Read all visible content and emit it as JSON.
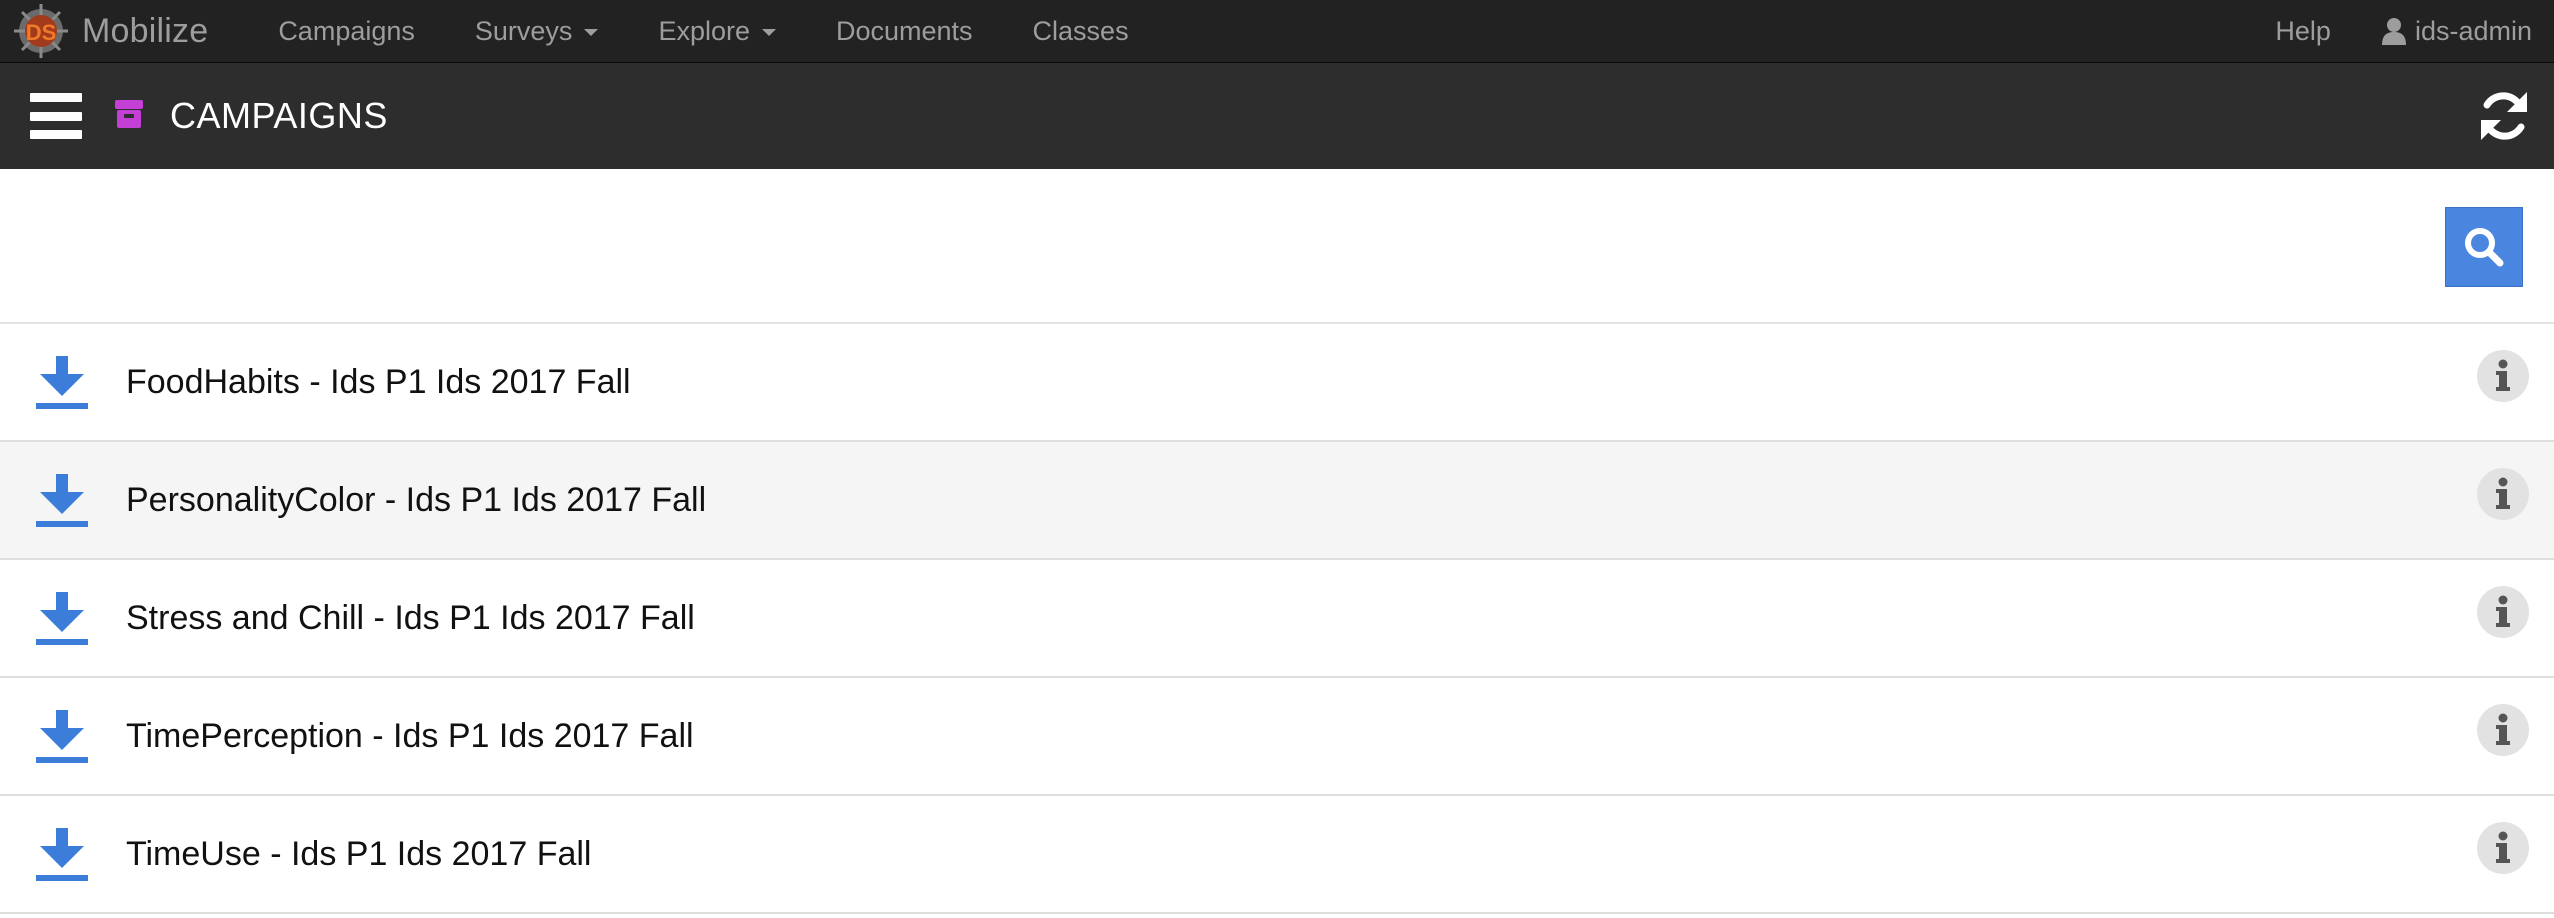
{
  "navbar": {
    "brand": "Mobilize",
    "items": [
      {
        "label": "Campaigns",
        "dropdown": false
      },
      {
        "label": "Surveys",
        "dropdown": true
      },
      {
        "label": "Explore",
        "dropdown": true
      },
      {
        "label": "Documents",
        "dropdown": false
      },
      {
        "label": "Classes",
        "dropdown": false
      }
    ],
    "help": "Help",
    "user": "ids-admin"
  },
  "header": {
    "title": "CAMPAIGNS",
    "icon": "archive-box-icon",
    "accent_color": "#c33fd6"
  },
  "search": {
    "icon": "search-icon",
    "button_color": "#4a86e0"
  },
  "campaigns": [
    {
      "name": "FoodHabits - Ids P1 Ids 2017 Fall"
    },
    {
      "name": "PersonalityColor - Ids P1 Ids 2017 Fall"
    },
    {
      "name": "Stress and Chill - Ids P1 Ids 2017 Fall"
    },
    {
      "name": "TimePerception - Ids P1 Ids 2017 Fall"
    },
    {
      "name": "TimeUse - Ids P1 Ids 2017 Fall"
    }
  ],
  "colors": {
    "navbar_bg": "#222222",
    "pagebar_bg": "#2d2d2d",
    "download_icon": "#3b7dd8",
    "info_bg": "#e2e2e2"
  }
}
